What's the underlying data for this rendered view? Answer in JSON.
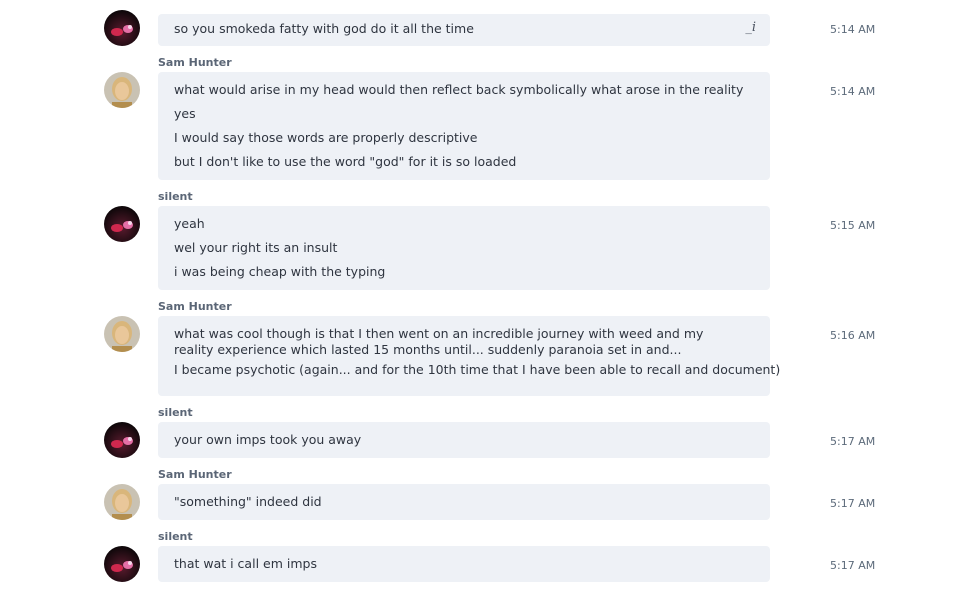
{
  "messages": [
    {
      "sender": "",
      "avatar": "silent-avatar",
      "lines": [
        "so you smokeda fatty with god  do it all the time"
      ],
      "time": "5:14 AM",
      "edit_icon": "_i"
    },
    {
      "sender": "Sam Hunter",
      "avatar": "sam-avatar",
      "lines": [
        "what would arise in my head would then reflect back symbolically what arose in the reality",
        "yes",
        "I would say those words are properly descriptive",
        "but I don't like to use the word \"god\" for it is so loaded"
      ],
      "time": "5:14 AM"
    },
    {
      "sender": "silent",
      "avatar": "silent-avatar",
      "lines": [
        "yeah",
        "wel your right its an insult",
        "i was being cheap with the typing"
      ],
      "time": "5:15 AM"
    },
    {
      "sender": "Sam Hunter",
      "avatar": "sam-avatar",
      "lines": [
        "what was cool though is that I then went on an incredible journey with weed and my reality experience which lasted 15 months until... suddenly paranoia set in and...",
        "I became psychotic (again...  and for the 10th time that I have been able to recall and document)"
      ],
      "time": "5:16 AM"
    },
    {
      "sender": "silent",
      "avatar": "silent-avatar",
      "lines": [
        "your own imps took you away"
      ],
      "time": "5:17 AM"
    },
    {
      "sender": "Sam Hunter",
      "avatar": "sam-avatar",
      "lines": [
        "\"something\" indeed did"
      ],
      "time": "5:17 AM"
    },
    {
      "sender": "silent",
      "avatar": "silent-avatar",
      "lines": [
        "that wat i call em imps"
      ],
      "time": "5:17 AM"
    }
  ]
}
